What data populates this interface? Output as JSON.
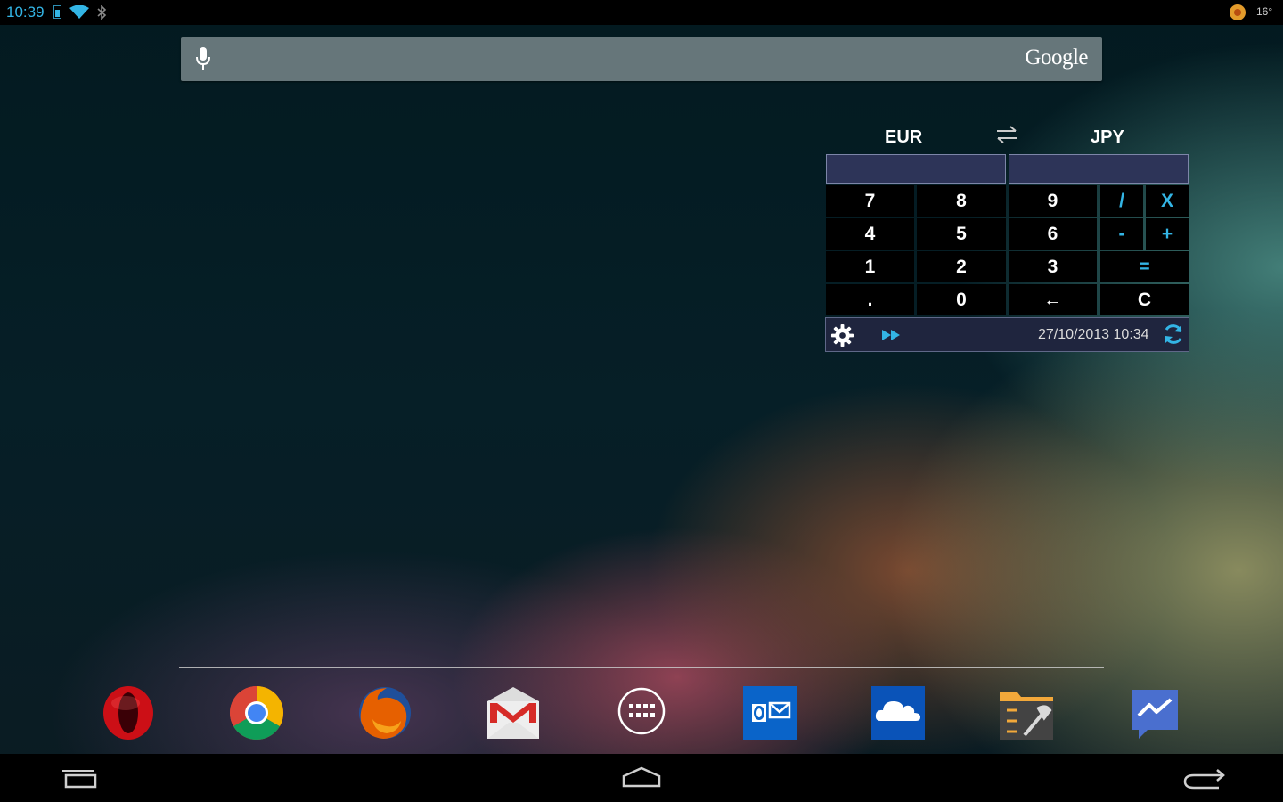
{
  "status_bar": {
    "time": "10:39",
    "temperature": "16°",
    "icons": [
      "battery-icon",
      "wifi-icon",
      "bluetooth-icon",
      "weather-icon"
    ]
  },
  "search_bar": {
    "logo_text": "Google",
    "icons": [
      "mic-icon"
    ]
  },
  "currency_widget": {
    "from_currency": "EUR",
    "to_currency": "JPY",
    "from_amount": "",
    "to_amount": "",
    "keypad": [
      [
        "7",
        "8",
        "9",
        "/",
        "X"
      ],
      [
        "4",
        "5",
        "6",
        "-",
        "+"
      ],
      [
        "1",
        "2",
        "3",
        "="
      ],
      [
        ".",
        "0",
        "←",
        "C"
      ]
    ],
    "last_updated": "27/10/2013 10:34",
    "icons": [
      "swap-icon",
      "settings-icon",
      "fast-forward-icon",
      "refresh-icon"
    ]
  },
  "dock": {
    "apps": [
      {
        "name": "opera",
        "icon": "opera-icon"
      },
      {
        "name": "chrome",
        "icon": "chrome-icon"
      },
      {
        "name": "firefox",
        "icon": "firefox-icon"
      },
      {
        "name": "gmail",
        "icon": "gmail-icon"
      },
      {
        "name": "app-drawer",
        "icon": "app-drawer-icon"
      },
      {
        "name": "outlook",
        "icon": "outlook-icon"
      },
      {
        "name": "skydrive",
        "icon": "cloud-icon"
      },
      {
        "name": "file-manager",
        "icon": "file-manager-icon"
      },
      {
        "name": "messenger",
        "icon": "messenger-icon"
      }
    ]
  },
  "nav_bar": {
    "buttons": [
      "recent-apps",
      "home",
      "back"
    ]
  },
  "colors": {
    "accent": "#33b5e5",
    "search_bar": "#66767a",
    "widget_input": "#2d3458",
    "key_background": "#000000"
  }
}
